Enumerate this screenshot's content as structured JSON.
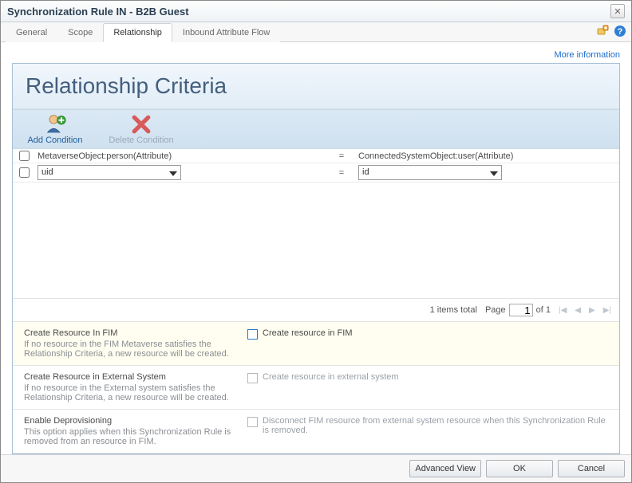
{
  "window": {
    "title": "Synchronization Rule IN - B2B Guest"
  },
  "tabs": {
    "items": [
      {
        "label": "General"
      },
      {
        "label": "Scope"
      },
      {
        "label": "Relationship"
      },
      {
        "label": "Inbound Attribute Flow"
      }
    ],
    "active": 2
  },
  "links": {
    "more_info": "More information"
  },
  "panel": {
    "title": "Relationship Criteria"
  },
  "toolbar": {
    "add_label": "Add Condition",
    "delete_label": "Delete Condition"
  },
  "grid": {
    "header_left": "MetaverseObject:person(Attribute)",
    "header_right": "ConnectedSystemObject:user(Attribute)",
    "eq": "=",
    "rows": [
      {
        "left_value": "uid",
        "right_value": "id"
      }
    ],
    "pager": {
      "total_text": "1 items total",
      "page_label": "Page",
      "current": "1",
      "of_text": "of 1"
    }
  },
  "options": {
    "create_fim": {
      "title": "Create Resource In FIM",
      "desc": "If no resource in the FIM Metaverse satisfies the Relationship Criteria, a new resource will be created.",
      "check_label": "Create resource in FIM"
    },
    "create_ext": {
      "title": "Create Resource in External System",
      "desc": "If no resource in the External system satisfies the Relationship Criteria, a new resource will be created.",
      "check_label": "Create resource in external system"
    },
    "deprov": {
      "title": "Enable Deprovisioning",
      "desc": "This option applies when this Synchronization Rule is removed from an resource in FIM.",
      "check_label": "Disconnect FIM resource from external system resource when this Synchronization Rule is removed."
    }
  },
  "footer": {
    "advanced": "Advanced View",
    "ok": "OK",
    "cancel": "Cancel"
  }
}
